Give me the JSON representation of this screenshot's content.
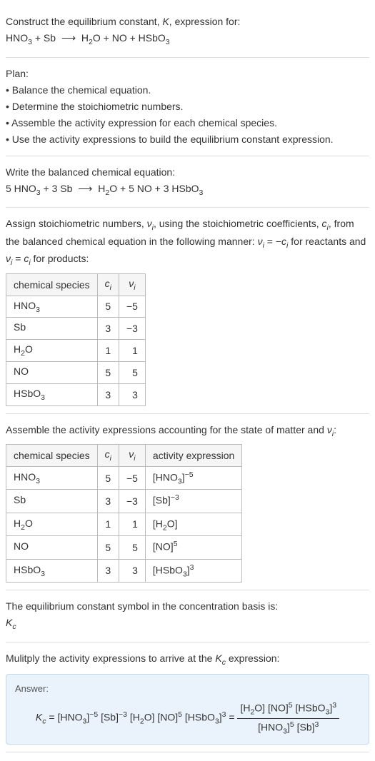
{
  "header": {
    "line1_pre": "Construct the equilibrium constant, ",
    "line1_K": "K",
    "line1_post": ", expression for:",
    "eq_lhs1": "HNO",
    "eq_lhs1_sub": "3",
    "eq_plus1": " + Sb ",
    "eq_arrow": "⟶",
    "eq_rhs": "  H",
    "eq_rhs_sub1": "2",
    "eq_rhs2": "O + NO + HSbO",
    "eq_rhs_sub2": "3"
  },
  "plan": {
    "title": "Plan:",
    "b1": "• Balance the chemical equation.",
    "b2": "• Determine the stoichiometric numbers.",
    "b3": "• Assemble the activity expression for each chemical species.",
    "b4": "• Use the activity expressions to build the equilibrium constant expression."
  },
  "balanced": {
    "intro": "Write the balanced chemical equation:",
    "lhs1": "5 HNO",
    "lhs1_sub": "3",
    "plus1": " + 3 Sb ",
    "arrow": "⟶",
    "rhs1": "  H",
    "rhs1_sub": "2",
    "rhs2": "O + 5 NO + 3 HSbO",
    "rhs2_sub": "3"
  },
  "stoich": {
    "intro1": "Assign stoichiometric numbers, ",
    "nu": "ν",
    "nu_sub": "i",
    "intro2": ", using the stoichiometric coefficients, ",
    "c": "c",
    "c_sub": "i",
    "intro3": ", from the balanced chemical equation in the following manner: ",
    "rel1_lhs": "ν",
    "rel1_lhs_sub": "i",
    "rel1_eq": " = −",
    "rel1_rhs": "c",
    "rel1_rhs_sub": "i",
    "rel1_post": " for reactants and ",
    "rel2_lhs": "ν",
    "rel2_lhs_sub": "i",
    "rel2_eq": " = ",
    "rel2_rhs": "c",
    "rel2_rhs_sub": "i",
    "rel2_post": " for products:",
    "headers": {
      "species": "chemical species",
      "ci": "c",
      "ci_sub": "i",
      "nui": "ν",
      "nui_sub": "i"
    },
    "rows": [
      {
        "species_pre": "HNO",
        "species_sub": "3",
        "species_post": "",
        "ci": "5",
        "nui": "−5"
      },
      {
        "species_pre": "Sb",
        "species_sub": "",
        "species_post": "",
        "ci": "3",
        "nui": "−3"
      },
      {
        "species_pre": "H",
        "species_sub": "2",
        "species_post": "O",
        "ci": "1",
        "nui": "1"
      },
      {
        "species_pre": "NO",
        "species_sub": "",
        "species_post": "",
        "ci": "5",
        "nui": "5"
      },
      {
        "species_pre": "HSbO",
        "species_sub": "3",
        "species_post": "",
        "ci": "3",
        "nui": "3"
      }
    ]
  },
  "activity": {
    "intro1": "Assemble the activity expressions accounting for the state of matter and ",
    "nu": "ν",
    "nu_sub": "i",
    "intro2": ":",
    "headers": {
      "species": "chemical species",
      "ci": "c",
      "ci_sub": "i",
      "nui": "ν",
      "nui_sub": "i",
      "act": "activity expression"
    },
    "rows": [
      {
        "sp_pre": "HNO",
        "sp_sub": "3",
        "sp_post": "",
        "ci": "5",
        "nui": "−5",
        "a_pre": "[HNO",
        "a_sub": "3",
        "a_mid": "]",
        "a_sup": "−5",
        "a_post": ""
      },
      {
        "sp_pre": "Sb",
        "sp_sub": "",
        "sp_post": "",
        "ci": "3",
        "nui": "−3",
        "a_pre": "[Sb]",
        "a_sub": "",
        "a_mid": "",
        "a_sup": "−3",
        "a_post": ""
      },
      {
        "sp_pre": "H",
        "sp_sub": "2",
        "sp_post": "O",
        "ci": "1",
        "nui": "1",
        "a_pre": "[H",
        "a_sub": "2",
        "a_mid": "O]",
        "a_sup": "",
        "a_post": ""
      },
      {
        "sp_pre": "NO",
        "sp_sub": "",
        "sp_post": "",
        "ci": "5",
        "nui": "5",
        "a_pre": "[NO]",
        "a_sub": "",
        "a_mid": "",
        "a_sup": "5",
        "a_post": ""
      },
      {
        "sp_pre": "HSbO",
        "sp_sub": "3",
        "sp_post": "",
        "ci": "3",
        "nui": "3",
        "a_pre": "[HSbO",
        "a_sub": "3",
        "a_mid": "]",
        "a_sup": "3",
        "a_post": ""
      }
    ]
  },
  "kc_symbol": {
    "line1": "The equilibrium constant symbol in the concentration basis is:",
    "K": "K",
    "K_sub": "c"
  },
  "multiply": {
    "line1_pre": "Mulitply the activity expressions to arrive at the ",
    "K": "K",
    "K_sub": "c",
    "line1_post": " expression:"
  },
  "answer": {
    "label": "Answer:",
    "lhs_K": "K",
    "lhs_K_sub": "c",
    "eq": " = ",
    "t1_pre": "[HNO",
    "t1_sub": "3",
    "t1_mid": "]",
    "t1_sup": "−5",
    "t2_pre": " [Sb]",
    "t2_sup": "−3",
    "t3_pre": " [H",
    "t3_sub": "2",
    "t3_mid": "O]",
    "t4_pre": " [NO]",
    "t4_sup": "5",
    "t5_pre": " [HSbO",
    "t5_sub": "3",
    "t5_mid": "]",
    "t5_sup": "3",
    "eq2": " = ",
    "num_t1_pre": "[H",
    "num_t1_sub": "2",
    "num_t1_mid": "O]",
    "num_t2_pre": " [NO]",
    "num_t2_sup": "5",
    "num_t3_pre": " [HSbO",
    "num_t3_sub": "3",
    "num_t3_mid": "]",
    "num_t3_sup": "3",
    "den_t1_pre": "[HNO",
    "den_t1_sub": "3",
    "den_t1_mid": "]",
    "den_t1_sup": "5",
    "den_t2_pre": " [Sb]",
    "den_t2_sup": "3"
  },
  "chart_data": {
    "type": "table",
    "tables": [
      {
        "title": "stoichiometric numbers",
        "columns": [
          "chemical species",
          "c_i",
          "ν_i"
        ],
        "rows": [
          [
            "HNO3",
            5,
            -5
          ],
          [
            "Sb",
            3,
            -3
          ],
          [
            "H2O",
            1,
            1
          ],
          [
            "NO",
            5,
            5
          ],
          [
            "HSbO3",
            3,
            3
          ]
        ]
      },
      {
        "title": "activity expressions",
        "columns": [
          "chemical species",
          "c_i",
          "ν_i",
          "activity expression"
        ],
        "rows": [
          [
            "HNO3",
            5,
            -5,
            "[HNO3]^-5"
          ],
          [
            "Sb",
            3,
            -3,
            "[Sb]^-3"
          ],
          [
            "H2O",
            1,
            1,
            "[H2O]"
          ],
          [
            "NO",
            5,
            5,
            "[NO]^5"
          ],
          [
            "HSbO3",
            3,
            3,
            "[HSbO3]^3"
          ]
        ]
      }
    ]
  }
}
